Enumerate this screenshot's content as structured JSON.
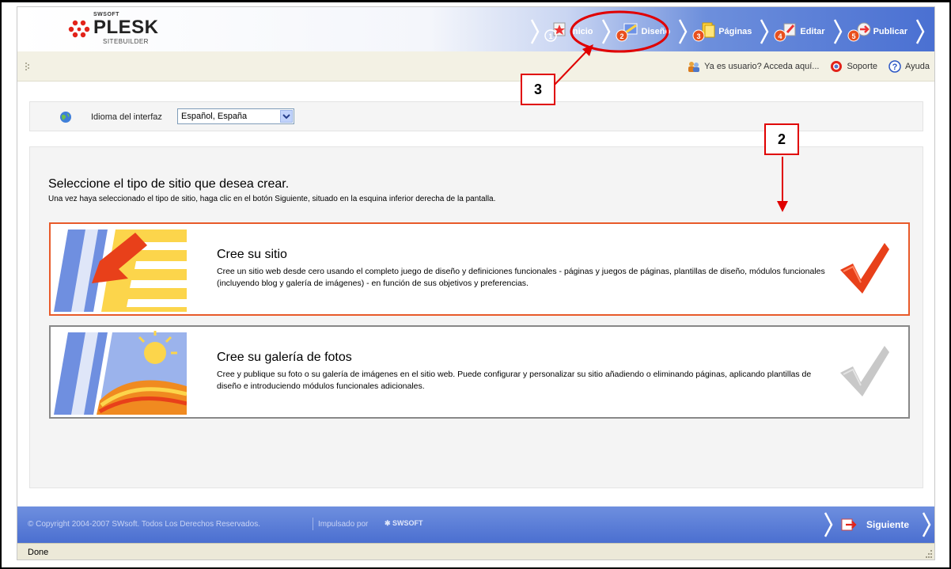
{
  "header": {
    "logo_top": "SWSOFT",
    "logo_main": "PLESK",
    "logo_sub": "SITEBUILDER",
    "steps": [
      {
        "num": "1",
        "label": "Inicio"
      },
      {
        "num": "2",
        "label": "Diseño"
      },
      {
        "num": "3",
        "label": "Páginas"
      },
      {
        "num": "4",
        "label": "Editar"
      },
      {
        "num": "5",
        "label": "Publicar"
      }
    ]
  },
  "subbar": {
    "login_label": "Ya es usuario? Acceda aquí...",
    "support_label": "Soporte",
    "help_label": "Ayuda"
  },
  "language": {
    "label": "Idioma del interfaz",
    "selected": "Español, España"
  },
  "main": {
    "title": "Seleccione el tipo de sitio que desea crear.",
    "subtitle": "Una vez haya seleccionado el tipo de sitio, haga clic en el botón Siguiente, situado en la esquina inferior derecha de la pantalla.",
    "options": [
      {
        "title": "Cree su sitio",
        "description": "Cree un sitio web desde cero usando el completo juego de diseño y definiciones funcionales - páginas y juegos de páginas, plantillas de diseño, módulos funcionales (incluyendo blog y galería de imágenes) - en función de sus objetivos y preferencias.",
        "selected": true
      },
      {
        "title": "Cree su galería de fotos",
        "description": "Cree y publique su foto o su galería de imágenes en el sitio web. Puede configurar y personalizar su sitio añadiendo o eliminando páginas, aplicando plantillas de diseño e introduciendo módulos funcionales adicionales.",
        "selected": false
      }
    ]
  },
  "footer": {
    "copyright": "© Copyright 2004-2007 SWsoft. Todos Los Derechos Reservados.",
    "powered": "Impulsado por",
    "powered_logo": "SWSOFT",
    "next_label": "Siguiente"
  },
  "statusbar": {
    "status": "Done"
  },
  "annotations": {
    "callout_2": "2",
    "callout_3": "3"
  },
  "colors": {
    "accent_blue": "#4a70d2",
    "selected_border": "#e85a2a",
    "annotation_red": "#e00000"
  }
}
